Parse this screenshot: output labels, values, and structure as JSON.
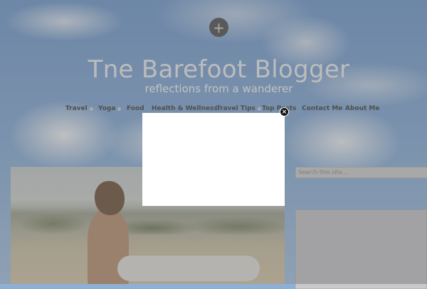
{
  "header": {
    "new_button_glyph": "+",
    "site_title": "Tne Barefoot Blogger",
    "tagline": "reflections from a wanderer"
  },
  "nav": {
    "items": [
      {
        "label": "Travel",
        "has_dropdown": true
      },
      {
        "label": "Yoga",
        "has_dropdown": true
      },
      {
        "label": "Food",
        "has_dropdown": false
      },
      {
        "label": "Health & Wellness",
        "has_dropdown": false
      },
      {
        "label": "Travel Tips",
        "has_dropdown": true
      },
      {
        "label": "Top Posts",
        "has_dropdown": false
      },
      {
        "label": "Contact Me",
        "has_dropdown": false
      },
      {
        "label": "About Me",
        "has_dropdown": false
      }
    ]
  },
  "sidebar": {
    "search_placeholder": "Search this site..."
  },
  "modal": {
    "close_glyph": "×"
  },
  "colors": {
    "overlay": "#6e6e6e",
    "modal_background": "#ffffff",
    "close_button": "#111111"
  }
}
